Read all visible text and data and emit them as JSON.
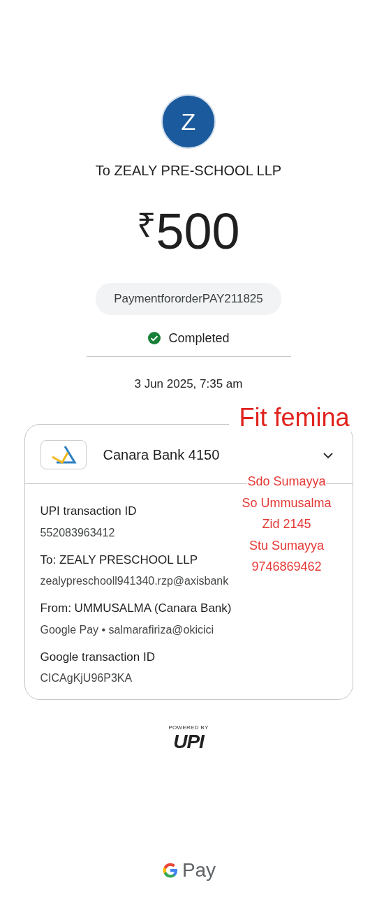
{
  "payee": {
    "initial": "Z",
    "title": "To ZEALY PRE-SCHOOL LLP"
  },
  "amount": {
    "currency": "₹",
    "value": "500"
  },
  "note": "PaymentfororderPAY211825",
  "status": {
    "kind": "completed",
    "label": "Completed"
  },
  "date": "3 Jun 2025, 7:35 am",
  "account": {
    "bank": "Canara Bank 4150",
    "expanded": false
  },
  "details": [
    {
      "label": "UPI transaction ID",
      "value": "552083963412"
    },
    {
      "label": "To: ZEALY PRESCHOOL LLP",
      "value": "zealypreschooll941340.rzp@axisbank"
    },
    {
      "label": "From: UMMUSALMA (Canara Bank)",
      "value": "Google Pay • salmarafiriza@okicici"
    },
    {
      "label": "Google transaction ID",
      "value": "CICAgKjU96P3KA"
    }
  ],
  "annotations": {
    "heading": "Fit femina",
    "lines": [
      "Sdo Sumayya",
      "So Ummusalma",
      "Zid 2145",
      "Stu Sumayya",
      "9746869462"
    ]
  },
  "footer": {
    "powered_by": "POWERED BY",
    "upi": "UPI",
    "brand": "Pay"
  }
}
